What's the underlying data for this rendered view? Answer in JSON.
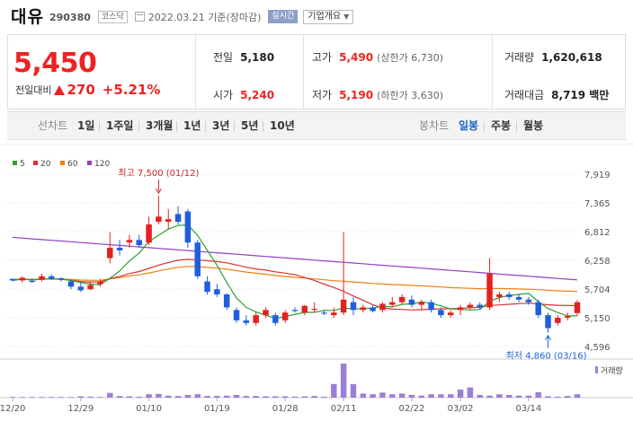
{
  "header": {
    "title": "대유",
    "code": "290380",
    "market": "코스닥",
    "date": "2022.03.21 기준(장마감)",
    "realtime": "실시간",
    "corp_info": "기업개요"
  },
  "price": {
    "current": "5,450",
    "change_label": "전일대비",
    "change": "270",
    "change_pct": "+5.21%"
  },
  "stats": {
    "prev_close_label": "전일",
    "prev_close": "5,180",
    "open_label": "시가",
    "open": "5,240",
    "high_label": "고가",
    "high": "5,490",
    "upper_limit": "(상한가 6,730)",
    "low_label": "저가",
    "low": "5,190",
    "lower_limit": "(하한가 3,630)",
    "volume_label": "거래량",
    "volume": "1,620,618",
    "amount_label": "거래대금",
    "amount": "8,719 백만"
  },
  "period_tabs": {
    "label": "선차트",
    "items": [
      "1일",
      "1주일",
      "3개월",
      "1년",
      "3년",
      "5년",
      "10년"
    ]
  },
  "candle_tabs": {
    "label": "봉차트",
    "items": [
      "일봉",
      "주봉",
      "월봉"
    ],
    "active": "일봉"
  },
  "colors": {
    "up": "#e22222",
    "down": "#1f5fdc",
    "ma5": "#2e9f2e",
    "ma20": "#e03030",
    "ma60": "#f08010",
    "ma120": "#9040c0",
    "volume": "#9b7fd6"
  },
  "chart_data": {
    "type": "candlestick",
    "legend": [
      "5",
      "20",
      "60",
      "120"
    ],
    "y_ticks": [
      "7,919",
      "7,365",
      "6,812",
      "6,258",
      "5,704",
      "5,150",
      "4,596"
    ],
    "y_range": [
      4596,
      7919
    ],
    "x_labels": [
      "12/20",
      "12/29",
      "01/10",
      "01/19",
      "01/28",
      "02/11",
      "02/22",
      "03/02",
      "03/14"
    ],
    "x_label_index": [
      0,
      7,
      14,
      21,
      28,
      34,
      41,
      46,
      53
    ],
    "max_annotation": "최고 7,500 (01/12)",
    "min_annotation": "최저 4,860 (03/16)",
    "max_index": 15,
    "min_index": 55,
    "volume_label": "거래량",
    "candles": [
      [
        5900,
        5900,
        5850,
        5870
      ],
      [
        5870,
        5950,
        5830,
        5920
      ],
      [
        5860,
        5910,
        5820,
        5840
      ],
      [
        5880,
        6000,
        5850,
        5950
      ],
      [
        5950,
        5990,
        5880,
        5900
      ],
      [
        5910,
        5930,
        5850,
        5880
      ],
      [
        5850,
        5880,
        5700,
        5750
      ],
      [
        5750,
        5850,
        5650,
        5680
      ],
      [
        5700,
        5850,
        5680,
        5780
      ],
      [
        5800,
        5900,
        5750,
        5850
      ],
      [
        6300,
        6800,
        6200,
        6500
      ],
      [
        6500,
        6650,
        6350,
        6450
      ],
      [
        6600,
        6750,
        6500,
        6650
      ],
      [
        6650,
        6750,
        6500,
        6550
      ],
      [
        6600,
        7100,
        6550,
        6950
      ],
      [
        7000,
        7500,
        6950,
        7100
      ],
      [
        7000,
        7250,
        6850,
        7050
      ],
      [
        7150,
        7300,
        6950,
        7000
      ],
      [
        7200,
        7250,
        6500,
        6600
      ],
      [
        6600,
        6650,
        5900,
        5950
      ],
      [
        5850,
        5950,
        5600,
        5650
      ],
      [
        5700,
        5800,
        5550,
        5600
      ],
      [
        5600,
        5620,
        5300,
        5350
      ],
      [
        5300,
        5350,
        5050,
        5100
      ],
      [
        5100,
        5200,
        5000,
        5050
      ],
      [
        5050,
        5250,
        5000,
        5200
      ],
      [
        5200,
        5350,
        5150,
        5300
      ],
      [
        5200,
        5250,
        5000,
        5050
      ],
      [
        5100,
        5300,
        5050,
        5250
      ],
      [
        5300,
        5350,
        5250,
        5280
      ],
      [
        5250,
        5400,
        5200,
        5380
      ],
      [
        5300,
        5450,
        5250,
        5320
      ],
      [
        5250,
        5300,
        5200,
        5230
      ],
      [
        5200,
        5350,
        5150,
        5250
      ],
      [
        5250,
        6800,
        5200,
        5500
      ],
      [
        5450,
        5550,
        5200,
        5300
      ],
      [
        5300,
        5400,
        5250,
        5350
      ],
      [
        5350,
        5400,
        5250,
        5280
      ],
      [
        5300,
        5450,
        5250,
        5420
      ],
      [
        5400,
        5550,
        5350,
        5450
      ],
      [
        5450,
        5600,
        5400,
        5550
      ],
      [
        5500,
        5580,
        5350,
        5400
      ],
      [
        5400,
        5500,
        5300,
        5450
      ],
      [
        5450,
        5500,
        5250,
        5300
      ],
      [
        5300,
        5350,
        5150,
        5200
      ],
      [
        5200,
        5300,
        5150,
        5250
      ],
      [
        5300,
        5400,
        5200,
        5350
      ],
      [
        5350,
        5450,
        5300,
        5400
      ],
      [
        5400,
        5450,
        5300,
        5350
      ],
      [
        5350,
        6300,
        5300,
        6000
      ],
      [
        5550,
        5650,
        5450,
        5600
      ],
      [
        5600,
        5650,
        5500,
        5550
      ],
      [
        5550,
        5600,
        5450,
        5500
      ],
      [
        5500,
        5550,
        5400,
        5450
      ],
      [
        5450,
        5500,
        5150,
        5200
      ],
      [
        5200,
        5250,
        4860,
        4950
      ],
      [
        5050,
        5200,
        5000,
        5150
      ],
      [
        5150,
        5250,
        5100,
        5180
      ],
      [
        5240,
        5490,
        5190,
        5450
      ]
    ],
    "volume": [
      0.02,
      0.02,
      0.02,
      0.02,
      0.02,
      0.02,
      0.02,
      0.04,
      0.03,
      0.02,
      0.14,
      0.05,
      0.04,
      0.03,
      0.1,
      0.11,
      0.06,
      0.05,
      0.08,
      0.1,
      0.05,
      0.05,
      0.06,
      0.08,
      0.05,
      0.05,
      0.04,
      0.04,
      0.04,
      0.03,
      0.04,
      0.05,
      0.03,
      0.4,
      1.0,
      0.4,
      0.12,
      0.1,
      0.15,
      0.1,
      0.12,
      0.08,
      0.06,
      0.1,
      0.1,
      0.1,
      0.24,
      0.3,
      0.08,
      0.06,
      0.1,
      0.08,
      0.06,
      0.06,
      0.16,
      0.04,
      0.03,
      0.05,
      0.1
    ]
  }
}
